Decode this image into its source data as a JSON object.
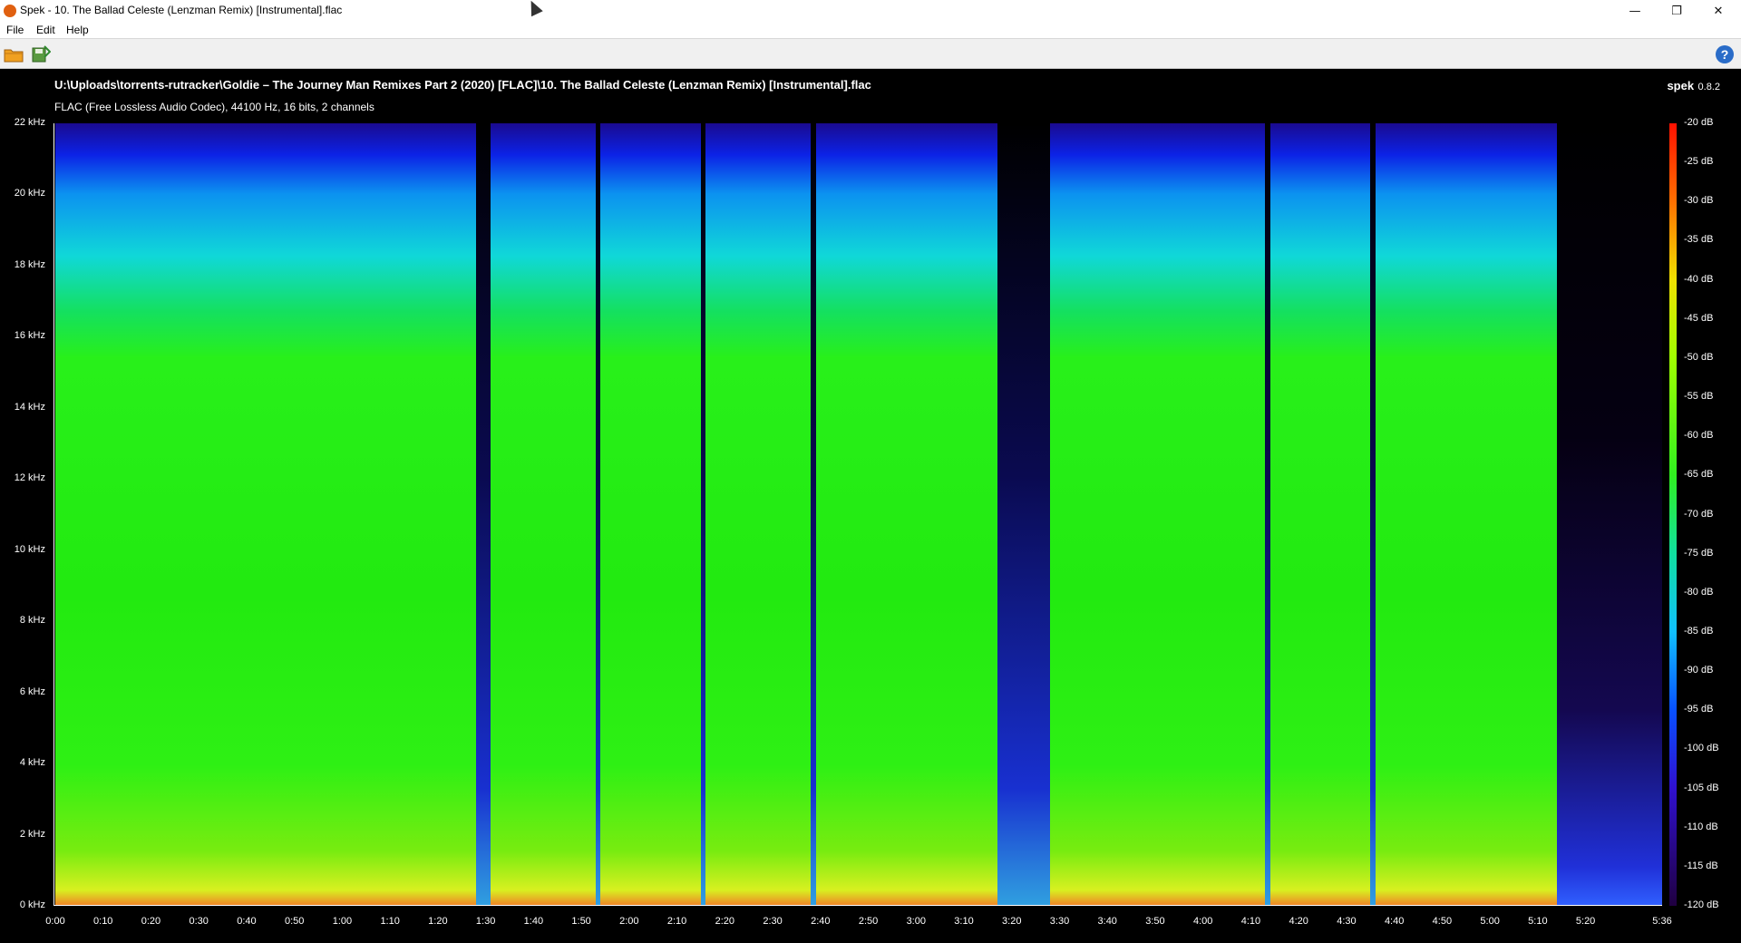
{
  "window": {
    "title": "Spek - 10. The Ballad Celeste (Lenzman Remix) [Instrumental].flac",
    "controls": {
      "minimize": "—",
      "maximize": "❐",
      "close": "✕"
    }
  },
  "menu": [
    {
      "label": "File"
    },
    {
      "label": "Edit"
    },
    {
      "label": "Help"
    }
  ],
  "toolbar": {
    "icons": [
      "open-file-icon",
      "save-icon",
      "help-icon"
    ],
    "help_glyph": "?"
  },
  "header": {
    "file_path": "U:\\Uploads\\torrents-rutracker\\Goldie – The Journey Man Remixes Part 2 (2020) [FLAC]\\10. The Ballad Celeste (Lenzman Remix) [Instrumental].flac",
    "audio_info": "FLAC (Free Lossless Audio Codec), 44100 Hz, 16 bits, 2 channels",
    "brand": "spek",
    "version": "0.8.2"
  },
  "chart_data": {
    "type": "heatmap",
    "title": "",
    "xlabel": "",
    "ylabel": "",
    "duration_seconds": 336,
    "frequency_max_khz": 22,
    "db_range": [
      -120,
      -20
    ],
    "y_ticks": [
      "22 kHz",
      "20 kHz",
      "18 kHz",
      "16 kHz",
      "14 kHz",
      "12 kHz",
      "10 kHz",
      "8 kHz",
      "6 kHz",
      "4 kHz",
      "2 kHz",
      "0 kHz"
    ],
    "x_ticks": [
      "0:00",
      "0:10",
      "0:20",
      "0:30",
      "0:40",
      "0:50",
      "1:00",
      "1:10",
      "1:20",
      "1:30",
      "1:40",
      "1:50",
      "2:00",
      "2:10",
      "2:20",
      "2:30",
      "2:40",
      "2:50",
      "3:00",
      "3:10",
      "3:20",
      "3:30",
      "3:40",
      "3:50",
      "4:00",
      "4:10",
      "4:20",
      "4:30",
      "4:40",
      "4:50",
      "5:00",
      "5:10",
      "5:20",
      "5:36"
    ],
    "colorbar_ticks": [
      "-20 dB",
      "-25 dB",
      "-30 dB",
      "-35 dB",
      "-40 dB",
      "-45 dB",
      "-50 dB",
      "-55 dB",
      "-60 dB",
      "-65 dB",
      "-70 dB",
      "-75 dB",
      "-80 dB",
      "-85 dB",
      "-90 dB",
      "-95 dB",
      "-100 dB",
      "-105 dB",
      "-110 dB",
      "-115 dB",
      "-120 dB"
    ],
    "quiet_gaps_seconds": [
      [
        88,
        91
      ],
      [
        113,
        114
      ],
      [
        135,
        136
      ],
      [
        158,
        159
      ],
      [
        197,
        208
      ],
      [
        253,
        254
      ],
      [
        275,
        276
      ]
    ],
    "fade_out_start_seconds": 314,
    "gap_color": "#0a0a50",
    "colors": {
      "high": "#ff1000",
      "mid": "#30f020",
      "low": "#200040"
    }
  }
}
